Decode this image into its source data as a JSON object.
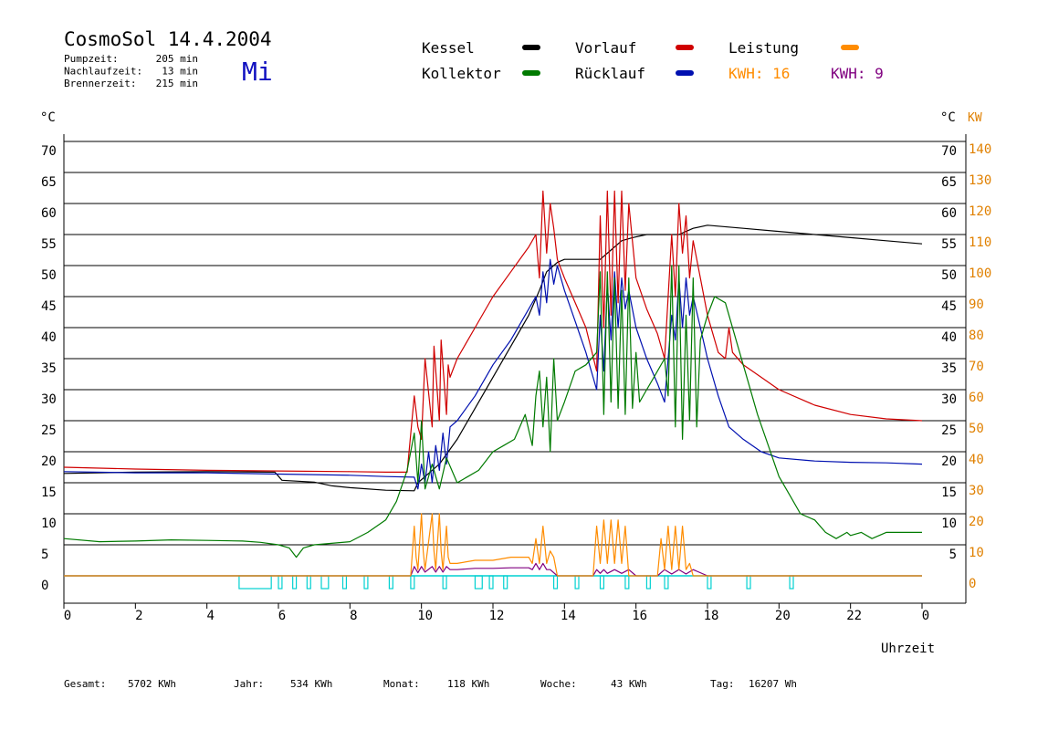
{
  "header": {
    "title": "CosmoSol 14.4.2004",
    "day": "Mi",
    "info": [
      {
        "label": "Pumpzeit:",
        "value": "205 min"
      },
      {
        "label": "Nachlaufzeit:",
        "value": "13 min"
      },
      {
        "label": "Brennerzeit:",
        "value": "215 min"
      }
    ]
  },
  "legend": {
    "kessel": "Kessel",
    "vorlauf": "Vorlauf",
    "leistung": "Leistung",
    "kollektor": "Kollektor",
    "ruecklauf": "Rücklauf",
    "kwh1": "KWH: 16",
    "kwh2": "KWH: 9"
  },
  "axes": {
    "left_unit": "°C",
    "right_unit_c": "°C",
    "right_unit_kw": "KW",
    "xlabel": "Uhrzeit"
  },
  "footer": {
    "gesamt_label": "Gesamt:",
    "gesamt_value": "5702 KWh",
    "jahr_label": "Jahr:",
    "jahr_value": "534 KWh",
    "monat_label": "Monat:",
    "monat_value": "118 KWh",
    "woche_label": "Woche:",
    "woche_value": "43 KWh",
    "tag_label": "Tag:",
    "tag_value": "16207 Wh"
  },
  "colors": {
    "kessel": "#000000",
    "kollektor": "#007a00",
    "vorlauf": "#d00000",
    "ruecklauf": "#0010b0",
    "leistung": "#ff8c00",
    "kwh2": "#800080",
    "pump": "#00d0d0",
    "title_blue": "#1010c0",
    "right_kw": "#e08000"
  },
  "chart_data": {
    "type": "line",
    "xlabel": "Uhrzeit",
    "xlim": [
      0,
      24
    ],
    "ylim_left": [
      0,
      70
    ],
    "ylim_right_kw": [
      0,
      140
    ],
    "x_tick_labels": [
      "0",
      "2",
      "4",
      "6",
      "8",
      "10",
      "12",
      "14",
      "16",
      "18",
      "20",
      "22",
      "0"
    ],
    "x_tick_values": [
      0,
      2,
      4,
      6,
      8,
      10,
      12,
      14,
      16,
      18,
      20,
      22,
      24
    ],
    "y_tick_labels": [
      "0",
      "5",
      "10",
      "15",
      "20",
      "25",
      "30",
      "35",
      "40",
      "45",
      "50",
      "55",
      "60",
      "65",
      "70"
    ],
    "y_tick_values": [
      0,
      5,
      10,
      15,
      20,
      25,
      30,
      35,
      40,
      45,
      50,
      55,
      60,
      65,
      70
    ],
    "right_c_tick_labels": [
      "5",
      "10",
      "15",
      "20",
      "25",
      "30",
      "35",
      "40",
      "45",
      "50",
      "55",
      "60",
      "65",
      "70"
    ],
    "right_kw_tick_labels": [
      "0",
      "10",
      "20",
      "30",
      "40",
      "50",
      "60",
      "70",
      "80",
      "90",
      "100",
      "110",
      "120",
      "130",
      "140"
    ],
    "grid": true,
    "series": [
      {
        "name": "Kessel",
        "key": "kessel",
        "x": [
          0,
          2,
          4,
          5.9,
          6.1,
          7,
          7.5,
          8,
          9,
          9.8,
          9.9,
          10.2,
          10.5,
          11,
          11.5,
          12,
          12.5,
          13,
          13.3,
          13.5,
          13.8,
          14,
          14.8,
          15,
          15.3,
          15.6,
          15.9,
          16.3,
          16.8,
          17.2,
          17.6,
          18,
          19,
          20,
          21,
          22,
          23,
          24
        ],
        "y": [
          16.5,
          16.7,
          16.8,
          16.7,
          15.4,
          15.1,
          14.5,
          14.2,
          13.8,
          13.7,
          15,
          16.5,
          18,
          22,
          27,
          32,
          37,
          42,
          46,
          49,
          50.5,
          51,
          51,
          51,
          52.5,
          54,
          54.5,
          55,
          55,
          55,
          56,
          56.5,
          56,
          55.5,
          55,
          54.5,
          54,
          53.5
        ]
      },
      {
        "name": "Kollektor",
        "key": "kollektor",
        "x": [
          0,
          1,
          2,
          3,
          4,
          5,
          5.5,
          6,
          6.3,
          6.5,
          6.7,
          7,
          8,
          8.5,
          9,
          9.3,
          9.6,
          9.8,
          9.9,
          10,
          10.1,
          10.3,
          10.5,
          10.7,
          11,
          11.3,
          11.6,
          12,
          12.3,
          12.6,
          12.9,
          13.1,
          13.2,
          13.3,
          13.4,
          13.5,
          13.6,
          13.7,
          13.8,
          14,
          14.3,
          14.6,
          14.9,
          15,
          15.1,
          15.2,
          15.3,
          15.4,
          15.5,
          15.6,
          15.7,
          15.8,
          15.9,
          16,
          16.1,
          16.3,
          16.5,
          16.8,
          16.9,
          17,
          17.1,
          17.2,
          17.3,
          17.4,
          17.5,
          17.6,
          17.7,
          17.8,
          18,
          18.2,
          18.5,
          18.8,
          19.1,
          19.4,
          19.7,
          20,
          20.3,
          20.6,
          21,
          21.3,
          21.6,
          21.9,
          22,
          22.3,
          22.6,
          23,
          23.5,
          24
        ],
        "y": [
          6,
          5.5,
          5.6,
          5.8,
          5.7,
          5.6,
          5.4,
          5,
          4.5,
          3,
          4.5,
          5,
          5.5,
          7,
          9,
          12,
          17,
          23,
          15,
          25,
          14,
          18,
          14,
          19,
          15,
          16,
          17,
          20,
          21,
          22,
          26,
          21,
          29,
          33,
          24,
          32,
          20,
          35,
          25,
          28,
          33,
          34,
          36,
          49,
          26,
          49,
          28,
          48,
          27,
          46,
          26,
          48,
          27,
          36,
          28,
          30,
          32,
          35,
          29,
          50,
          24,
          50,
          22,
          42,
          25,
          48,
          24,
          38,
          42,
          45,
          44,
          38,
          32,
          26,
          21,
          16,
          13,
          10,
          9,
          7,
          6,
          7,
          6.5,
          7,
          6,
          7,
          7,
          7
        ]
      },
      {
        "name": "Vorlauf",
        "key": "vorlauf",
        "x": [
          0,
          2,
          4,
          6,
          8,
          9,
          9.6,
          9.8,
          9.9,
          10,
          10.1,
          10.3,
          10.35,
          10.5,
          10.55,
          10.7,
          10.75,
          10.8,
          11,
          11.5,
          12,
          12.5,
          13,
          13.2,
          13.3,
          13.4,
          13.5,
          13.6,
          13.7,
          13.8,
          14,
          14.3,
          14.6,
          14.9,
          15,
          15.1,
          15.2,
          15.3,
          15.4,
          15.5,
          15.6,
          15.7,
          15.8,
          16,
          16.3,
          16.6,
          16.8,
          17,
          17.1,
          17.2,
          17.3,
          17.4,
          17.5,
          17.6,
          17.8,
          18,
          18.3,
          18.5,
          18.6,
          18.7,
          19,
          19.5,
          20,
          21,
          22,
          23,
          24
        ],
        "y": [
          17.5,
          17.2,
          17,
          16.9,
          16.8,
          16.7,
          16.7,
          29,
          24,
          22,
          35,
          24,
          37,
          25,
          38,
          26,
          34,
          32,
          35,
          40,
          45,
          49,
          53,
          55,
          48,
          62,
          52,
          60,
          56,
          51,
          48,
          44,
          40,
          33,
          58,
          40,
          62,
          42,
          62,
          44,
          62,
          46,
          60,
          48,
          43,
          39,
          35,
          55,
          45,
          60,
          52,
          58,
          48,
          54,
          48,
          42,
          36,
          35,
          40,
          36,
          34,
          32,
          30,
          27.5,
          26,
          25.3,
          25
        ]
      },
      {
        "name": "Rücklauf",
        "key": "ruecklauf",
        "x": [
          0,
          2,
          4,
          6,
          8,
          9,
          9.8,
          9.9,
          10,
          10.1,
          10.2,
          10.3,
          10.4,
          10.5,
          10.6,
          10.7,
          10.8,
          11,
          11.5,
          12,
          12.5,
          13,
          13.2,
          13.3,
          13.4,
          13.5,
          13.6,
          13.7,
          13.8,
          14,
          14.3,
          14.6,
          14.9,
          15,
          15.1,
          15.2,
          15.3,
          15.4,
          15.5,
          15.6,
          15.7,
          15.8,
          16,
          16.3,
          16.6,
          16.8,
          17,
          17.1,
          17.2,
          17.3,
          17.4,
          17.5,
          17.6,
          17.8,
          18,
          18.3,
          18.6,
          19,
          19.5,
          20,
          21,
          22,
          23,
          24
        ],
        "y": [
          16.8,
          16.6,
          16.6,
          16.4,
          16.2,
          16,
          15.9,
          14,
          18,
          15,
          20,
          15,
          21,
          17,
          23,
          18,
          24,
          25,
          29,
          34,
          38,
          43,
          45,
          42,
          49,
          44,
          51,
          47,
          50,
          46,
          41,
          36,
          30,
          42,
          33,
          47,
          38,
          49,
          40,
          48,
          43,
          46,
          40,
          35,
          31,
          28,
          42,
          38,
          48,
          40,
          48,
          42,
          45,
          40,
          35,
          29,
          24,
          22,
          20,
          19,
          18.5,
          18.3,
          18.2,
          18
        ]
      },
      {
        "name": "Leistung",
        "key": "leistung",
        "x": [
          0,
          9.7,
          9.8,
          9.85,
          9.9,
          10,
          10.05,
          10.1,
          10.3,
          10.35,
          10.4,
          10.5,
          10.55,
          10.6,
          10.7,
          10.75,
          10.8,
          11,
          11.5,
          12,
          12.5,
          13,
          13.1,
          13.2,
          13.3,
          13.4,
          13.5,
          13.6,
          13.7,
          13.8,
          14,
          14.8,
          14.9,
          15,
          15.1,
          15.2,
          15.3,
          15.4,
          15.5,
          15.6,
          15.7,
          15.8,
          16,
          16.6,
          16.7,
          16.8,
          16.9,
          17,
          17.1,
          17.2,
          17.3,
          17.4,
          17.5,
          17.6,
          18,
          24
        ],
        "y": [
          0,
          0,
          8,
          3,
          1,
          10,
          4,
          1,
          10,
          4,
          1,
          10,
          4,
          1,
          8,
          3,
          2,
          2,
          2.5,
          2.5,
          3,
          3,
          2,
          6,
          2,
          8,
          2,
          4,
          3,
          0,
          0,
          0,
          8,
          2,
          9,
          2,
          9,
          2,
          9,
          2,
          8,
          0,
          0,
          0,
          6,
          1,
          8,
          1,
          8,
          1,
          8,
          1,
          2,
          0,
          0,
          0
        ]
      },
      {
        "name": "KWH: 9",
        "key": "kwh2",
        "x": [
          0,
          9.7,
          9.8,
          9.9,
          10,
          10.1,
          10.3,
          10.4,
          10.5,
          10.6,
          10.7,
          10.8,
          11,
          11.5,
          12,
          12.5,
          13,
          13.1,
          13.2,
          13.3,
          13.4,
          13.5,
          13.6,
          13.8,
          14,
          14.8,
          14.9,
          15,
          15.1,
          15.2,
          15.4,
          15.6,
          15.8,
          16,
          16.6,
          16.8,
          17,
          17.2,
          17.4,
          17.6,
          18,
          24
        ],
        "y": [
          0,
          0,
          1.5,
          0.5,
          1.5,
          0.6,
          1.5,
          0.6,
          1.5,
          0.6,
          1.5,
          1,
          1,
          1.2,
          1.2,
          1.3,
          1.3,
          1,
          2,
          1,
          2,
          1,
          1,
          0,
          0,
          0,
          1,
          0.4,
          1,
          0.4,
          1,
          0.4,
          1,
          0,
          0,
          1,
          0.3,
          1,
          0.3,
          1,
          0,
          0
        ]
      }
    ],
    "pump_intervals": [
      [
        4.9,
        5.8
      ],
      [
        6.0,
        6.1
      ],
      [
        6.4,
        6.5
      ],
      [
        6.8,
        6.9
      ],
      [
        7.2,
        7.4
      ],
      [
        7.8,
        7.9
      ],
      [
        8.4,
        8.5
      ],
      [
        9.1,
        9.2
      ],
      [
        9.7,
        9.8
      ],
      [
        10.6,
        10.7
      ],
      [
        11.5,
        11.7
      ],
      [
        11.9,
        12.0
      ],
      [
        12.3,
        12.4
      ],
      [
        13.7,
        13.8
      ],
      [
        14.3,
        14.4
      ],
      [
        15.0,
        15.1
      ],
      [
        15.7,
        15.8
      ],
      [
        16.3,
        16.4
      ],
      [
        16.8,
        16.9
      ],
      [
        18.0,
        18.1
      ],
      [
        19.1,
        19.2
      ],
      [
        20.3,
        20.4
      ]
    ]
  }
}
